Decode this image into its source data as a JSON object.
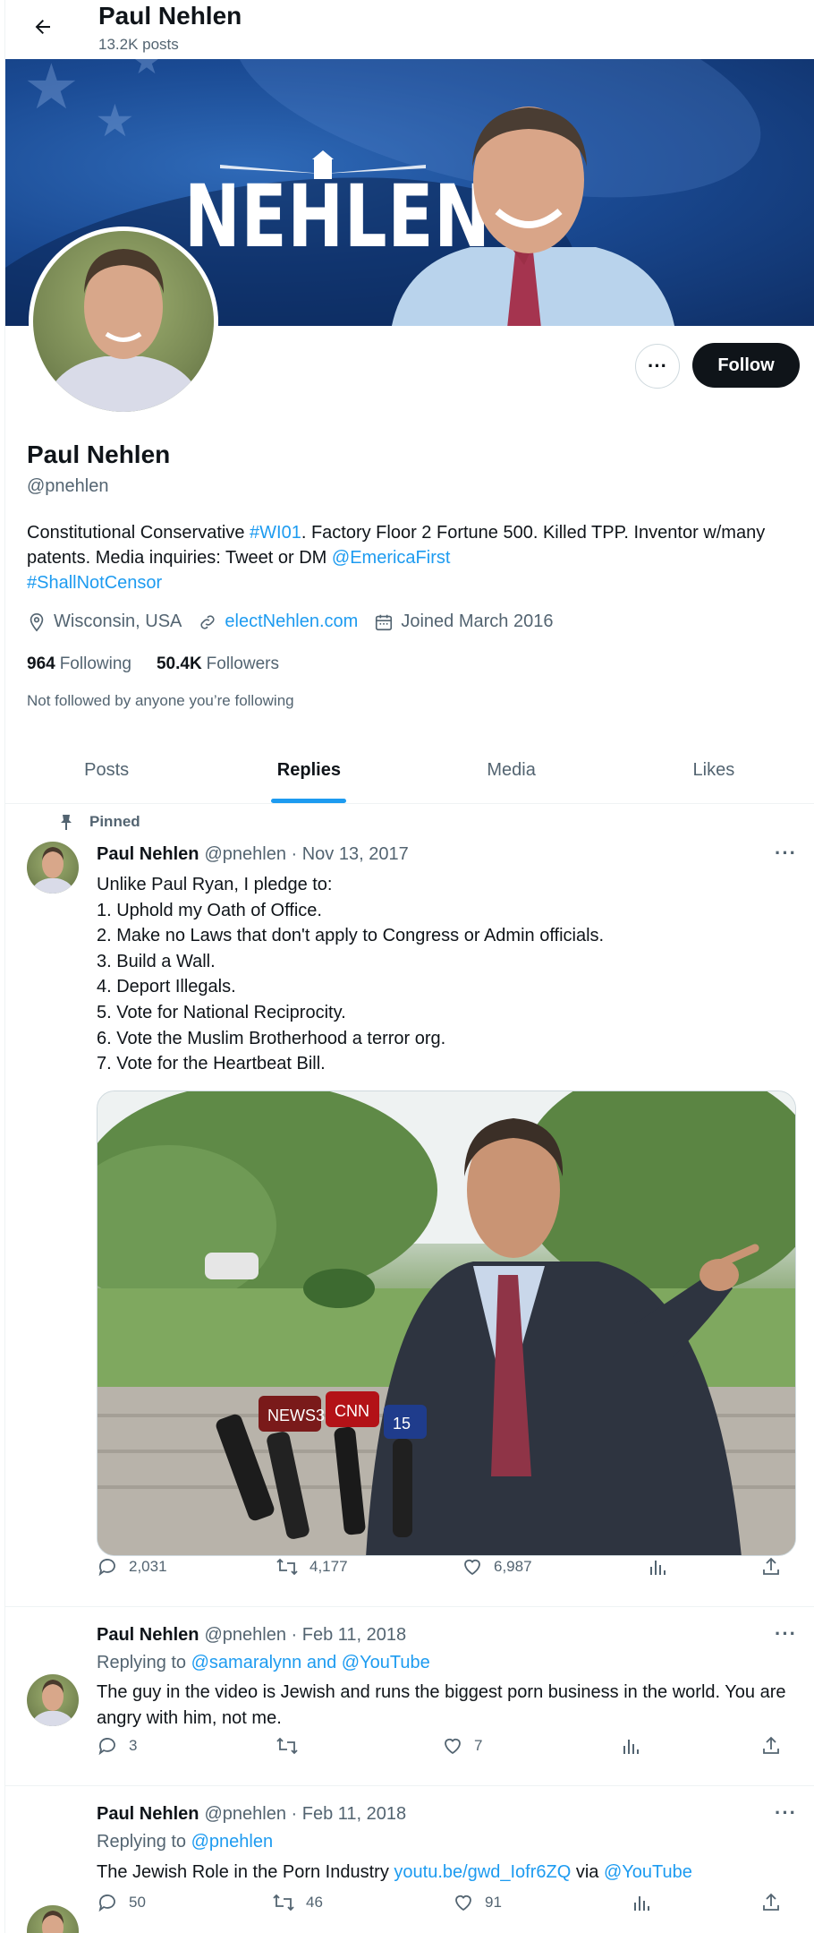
{
  "header": {
    "name": "Paul Nehlen",
    "posts": "13.2K posts"
  },
  "banner": {
    "title": "NEHLEN"
  },
  "profile": {
    "name": "Paul Nehlen",
    "handle": "@pnehlen",
    "follow_label": "Follow",
    "bio": {
      "t1": "Constitutional Conservative ",
      "tag1": "#WI01",
      "t2": ". Factory Floor 2 Fortune 500. Killed TPP. Inventor w/many patents. Media inquiries: Tweet or DM ",
      "mention": "@EmericaFirst",
      "tag2": "#ShallNotCensor"
    },
    "location": "Wisconsin, USA",
    "website": "electNehlen.com",
    "joined": "Joined March 2016",
    "following_count": "964",
    "following_label": "Following",
    "followers_count": "50.4K",
    "followers_label": "Followers",
    "not_followed": "Not followed by anyone you’re following"
  },
  "tabs": [
    {
      "label": "Posts"
    },
    {
      "label": "Replies"
    },
    {
      "label": "Media"
    },
    {
      "label": "Likes"
    }
  ],
  "active_tab": "Replies",
  "tweets": [
    {
      "pinned_label": "Pinned",
      "name": "Paul Nehlen",
      "meta": "@pnehlen · Nov 13, 2017",
      "text": "Unlike Paul Ryan, I pledge to:\n1. Uphold my Oath of Office.\n2. Make no Laws that don't apply to Congress or Admin officials.\n3. Build a Wall.\n4. Deport Illegals.\n5. Vote for National Reciprocity.\n6. Vote the Muslim Brotherhood a terror org.\n7. Vote for the Heartbeat Bill.",
      "mic_labels": [
        "NEWS3",
        "CNN",
        "15"
      ],
      "replies": "2,031",
      "retweets": "4,177",
      "likes": "6,987"
    },
    {
      "name": "Paul Nehlen",
      "meta": "@pnehlen · Feb 11, 2018",
      "replying_prefix": "Replying to ",
      "replying_to": "@samaralynn and @YouTube",
      "text": "The guy in the video is Jewish and runs the biggest porn business in the world. You are angry with him, not me.",
      "replies": "3",
      "retweets": "",
      "likes": "7"
    },
    {
      "name": "Paul Nehlen",
      "meta": "@pnehlen · Feb 11, 2018",
      "replying_prefix": "Replying to ",
      "replying_to": "@pnehlen",
      "text_pre": "The Jewish Role in the Porn Industry ",
      "link": "youtu.be/gwd_Iofr6ZQ",
      "text_mid": " via ",
      "mention": "@YouTube",
      "replies": "50",
      "retweets": "46",
      "likes": "91"
    }
  ],
  "colors": {
    "accent": "#1d9bf0",
    "text": "#0f1419",
    "secondary": "#536471",
    "border": "#eff3f4"
  },
  "icons": [
    "back-arrow-icon",
    "pin-icon",
    "location-icon",
    "link-icon",
    "calendar-icon",
    "reply-icon",
    "retweet-icon",
    "like-icon",
    "views-icon",
    "share-icon",
    "more-icon"
  ]
}
